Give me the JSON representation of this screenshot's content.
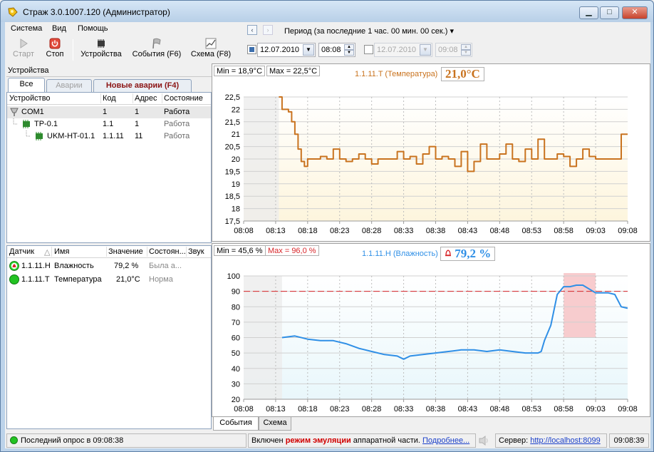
{
  "window": {
    "title": "Страж 3.0.1007.120 (Администратор)",
    "min": "▁",
    "max": "□",
    "close": "✕"
  },
  "menu": [
    "Система",
    "Вид",
    "Помощь"
  ],
  "toolbar": {
    "start": "Старт",
    "stop": "Стоп",
    "devices": "Устройства",
    "events": "События (F6)",
    "scheme": "Схема (F8)"
  },
  "devices_panel": {
    "title": "Устройства",
    "tabs": [
      "Все",
      "Аварии",
      "Новые аварии (F4)"
    ],
    "columns": [
      "Устройство",
      "Код",
      "Адрес",
      "Состояние"
    ],
    "rows": [
      {
        "name": "COM1",
        "code": "1",
        "address": "1",
        "state": "Работа"
      },
      {
        "name": "TP-0.1",
        "code": "1.1",
        "address": "1",
        "state": "Работа"
      },
      {
        "name": "UKM-HT-01.1",
        "code": "1.1.11",
        "address": "11",
        "state": "Работа"
      }
    ]
  },
  "sensors_panel": {
    "columns": [
      "Датчик",
      "Имя",
      "Значение",
      "Состоян...",
      "Звук"
    ],
    "rows": [
      {
        "sensor": "1.1.11.H",
        "name": "Влажность",
        "value": "79,2 %",
        "state": "Была а...",
        "status": "alarm"
      },
      {
        "sensor": "1.1.11.T",
        "name": "Температура",
        "value": "21,0°C",
        "state": "Норма",
        "status": "ok"
      }
    ]
  },
  "nav": {
    "prev": "‹",
    "next": "›",
    "period": "Период (за последние 1 час. 00 мин. 00 сек.)",
    "period_arrow": "▾",
    "from_date": "12.07.2010",
    "from_time": "08:08",
    "to_date": "12.07.2010",
    "to_time": "09:08"
  },
  "colors": {
    "temp": "#c9731f",
    "hum": "#2f8fe6",
    "alarm": "#d8262a",
    "ok": "#22c322"
  },
  "temp_chart": {
    "min_label": "Min = 18,9°C",
    "max_label": "Max = 22,5°C",
    "series_title": "1.1.11.T (Температура)",
    "value": "21,0°C"
  },
  "hum_chart": {
    "min_label": "Min = 45,6 %",
    "max_label": "Max = 96,0 %",
    "series_title": "1.1.11.H (Влажность)",
    "value": "79,2 %"
  },
  "chart_data": [
    {
      "type": "line",
      "series": [
        {
          "name": "1.1.11.T (Температура)",
          "x": [
            "08:13.5",
            "08:14",
            "08:15",
            "08:15.5",
            "08:16",
            "08:16.5",
            "08:17",
            "08:17.5",
            "08:18",
            "08:19",
            "08:20",
            "08:21",
            "08:22",
            "08:23",
            "08:24",
            "08:25",
            "08:26",
            "08:27",
            "08:28",
            "08:29",
            "08:30",
            "08:31",
            "08:32",
            "08:33",
            "08:34",
            "08:35",
            "08:36",
            "08:37",
            "08:38",
            "08:39",
            "08:40",
            "08:41",
            "08:42",
            "08:43",
            "08:44",
            "08:45",
            "08:46",
            "08:47",
            "08:48",
            "08:49",
            "08:50",
            "08:51",
            "08:52",
            "08:53",
            "08:54",
            "08:55",
            "08:56",
            "08:57",
            "08:58",
            "08:59",
            "09:00",
            "09:01",
            "09:02",
            "09:03",
            "09:04",
            "09:05",
            "09:06",
            "09:07",
            "09:08"
          ],
          "values": [
            22.5,
            22.0,
            21.9,
            21.5,
            21.0,
            20.4,
            19.9,
            19.7,
            20.0,
            20.0,
            20.1,
            20.0,
            20.4,
            20.0,
            19.9,
            20.0,
            20.2,
            20.0,
            19.8,
            20.0,
            20.0,
            20.0,
            20.3,
            20.0,
            20.1,
            19.8,
            20.2,
            20.5,
            20.0,
            20.1,
            20.0,
            19.7,
            20.3,
            19.5,
            19.9,
            20.6,
            20.0,
            20.0,
            20.2,
            20.6,
            20.0,
            19.9,
            20.4,
            20.0,
            20.8,
            20.0,
            20.0,
            20.2,
            20.1,
            19.7,
            20.0,
            20.4,
            20.1,
            20.0,
            20.0,
            20.0,
            20.0,
            21.0,
            21.0
          ]
        }
      ],
      "x_ticks": [
        "08:08",
        "08:13",
        "08:18",
        "08:23",
        "08:28",
        "08:33",
        "08:38",
        "08:43",
        "08:48",
        "08:53",
        "08:58",
        "09:03",
        "09:08"
      ],
      "y_ticks": [
        "22,5",
        "22",
        "21,5",
        "21",
        "20,5",
        "20",
        "19,5",
        "19",
        "18,5",
        "18",
        "17,5"
      ],
      "ylim": [
        17.5,
        22.5
      ],
      "grid": true
    },
    {
      "type": "line",
      "series": [
        {
          "name": "1.1.11.H (Влажность)",
          "x": [
            "08:14",
            "08:16",
            "08:18",
            "08:20",
            "08:22",
            "08:24",
            "08:26",
            "08:28",
            "08:30",
            "08:32",
            "08:33",
            "08:34",
            "08:36",
            "08:38",
            "08:40",
            "08:42",
            "08:44",
            "08:46",
            "08:48",
            "08:50",
            "08:52",
            "08:54",
            "08:54.5",
            "08:55",
            "08:56",
            "08:57",
            "08:58",
            "08:59",
            "09:00",
            "09:01",
            "09:03",
            "09:04",
            "09:05",
            "09:06",
            "09:07",
            "09:08"
          ],
          "values": [
            60,
            61,
            59,
            58,
            58,
            56,
            53,
            51,
            49,
            48,
            46,
            48,
            49,
            50,
            51,
            52,
            52,
            51,
            52,
            51,
            50,
            50,
            51,
            58,
            68,
            88,
            93,
            93,
            94,
            94,
            89,
            89,
            89,
            88,
            80,
            79
          ]
        }
      ],
      "x_ticks": [
        "08:08",
        "08:13",
        "08:18",
        "08:23",
        "08:28",
        "08:33",
        "08:38",
        "08:43",
        "08:48",
        "08:53",
        "08:58",
        "09:03",
        "09:08"
      ],
      "y_ticks": [
        "100",
        "90",
        "80",
        "70",
        "60",
        "50",
        "40",
        "30",
        "20"
      ],
      "ylim": [
        20,
        100
      ],
      "threshold": 90,
      "alarm_span": [
        "08:58",
        "09:03"
      ],
      "grid": true
    }
  ],
  "bottom_tabs": [
    "События",
    "Схема"
  ],
  "status": {
    "last_poll": "Последний опрос в 09:08:38",
    "emul_prefix": "Включен ",
    "emul_mode": "режим эмуляции",
    "emul_suffix": " аппаратной части. ",
    "emul_link": "Подробнее...",
    "server_label": "Сервер: ",
    "server_url": "http://localhost:8099",
    "clock": "09:08:39"
  }
}
